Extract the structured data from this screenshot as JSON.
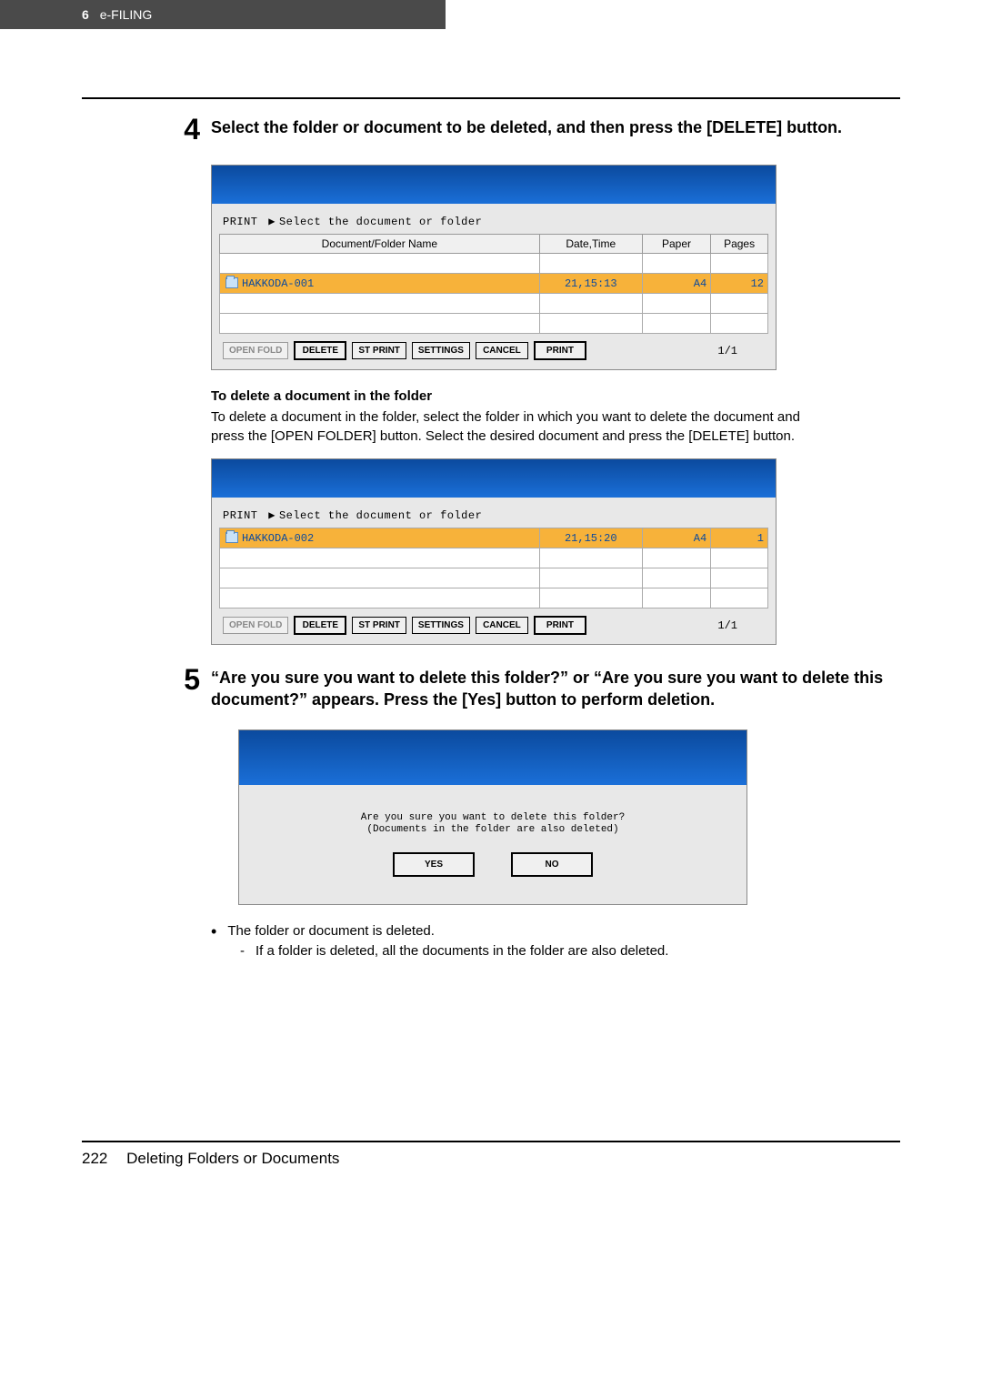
{
  "header": {
    "page_num": "6",
    "section": "e-FILING"
  },
  "step4": {
    "num": "4",
    "text": "Select the folder or document to be deleted, and then press the [DELETE] button."
  },
  "screenshot1": {
    "prompt_left": "PRINT",
    "prompt_msg": "Select the document or folder",
    "headers": {
      "name": "Document/Folder Name",
      "date": "Date,Time",
      "paper": "Paper",
      "pages": "Pages"
    },
    "row": {
      "name": "HAKKODA-001",
      "date": "21,15:13",
      "paper": "A4",
      "pages": "12"
    },
    "buttons": {
      "open": "OPEN FOLD",
      "delete": "DELETE",
      "stprint": "ST PRINT",
      "settings": "SETTINGS",
      "cancel": "CANCEL",
      "print": "PRINT"
    },
    "pager": "1/1"
  },
  "sub4": {
    "title": "To delete a document in the folder",
    "para": "To delete a document in the folder, select the folder in which you want to delete the document and press the [OPEN FOLDER] button. Select the desired document and press the [DELETE] button."
  },
  "screenshot2": {
    "prompt_left": "PRINT",
    "prompt_msg": "Select the document or folder",
    "row": {
      "name": "HAKKODA-002",
      "date": "21,15:20",
      "paper": "A4",
      "pages": "1"
    },
    "buttons": {
      "open": "OPEN FOLD",
      "delete": "DELETE",
      "stprint": "ST PRINT",
      "settings": "SETTINGS",
      "cancel": "CANCEL",
      "print": "PRINT"
    },
    "pager": "1/1"
  },
  "step5": {
    "num": "5",
    "text": "“Are you sure you want to delete this folder?” or “Are you sure you want to delete this document?” appears. Press the [Yes] button to perform deletion."
  },
  "screenshot3": {
    "line1": "Are you sure you want to delete this folder?",
    "line2": "(Documents in the folder are also deleted)",
    "yes": "YES",
    "no": "NO"
  },
  "bullets": {
    "b1": "The folder or document is deleted.",
    "b2": "If a folder is deleted, all the documents in the folder are also deleted."
  },
  "footer": {
    "page": "222",
    "title": "Deleting Folders or Documents"
  }
}
